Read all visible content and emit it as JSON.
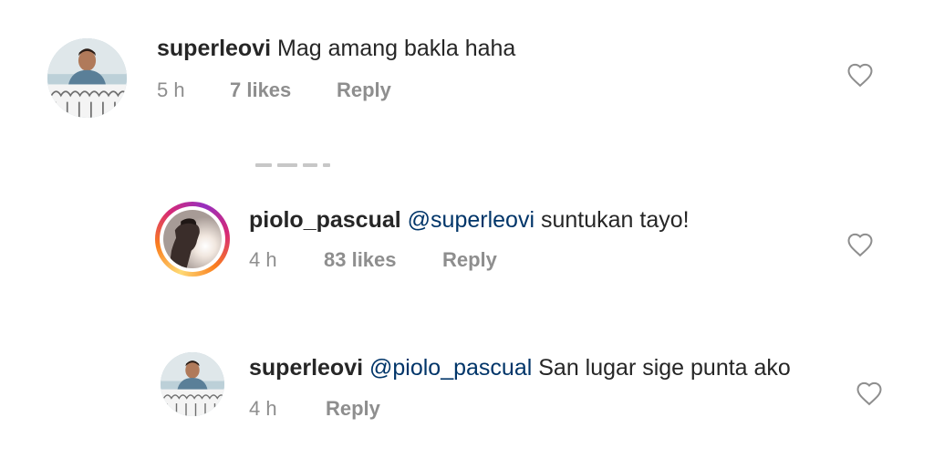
{
  "comments": [
    {
      "username": "superleovi",
      "mention": "",
      "text": "Mag amang bakla haha",
      "time": "5 h",
      "likes": "7 likes",
      "reply": "Reply"
    },
    {
      "username": "piolo_pascual",
      "mention": "@superleovi",
      "text": "suntukan tayo!",
      "time": "4 h",
      "likes": "83 likes",
      "reply": "Reply"
    },
    {
      "username": "superleovi",
      "mention": "@piolo_pascual",
      "text": "San lugar sige punta ako",
      "time": "4 h",
      "likes": "",
      "reply": "Reply"
    }
  ],
  "icons": {
    "like": "heart-outline-icon",
    "story_ring": "instagram-gradient"
  }
}
